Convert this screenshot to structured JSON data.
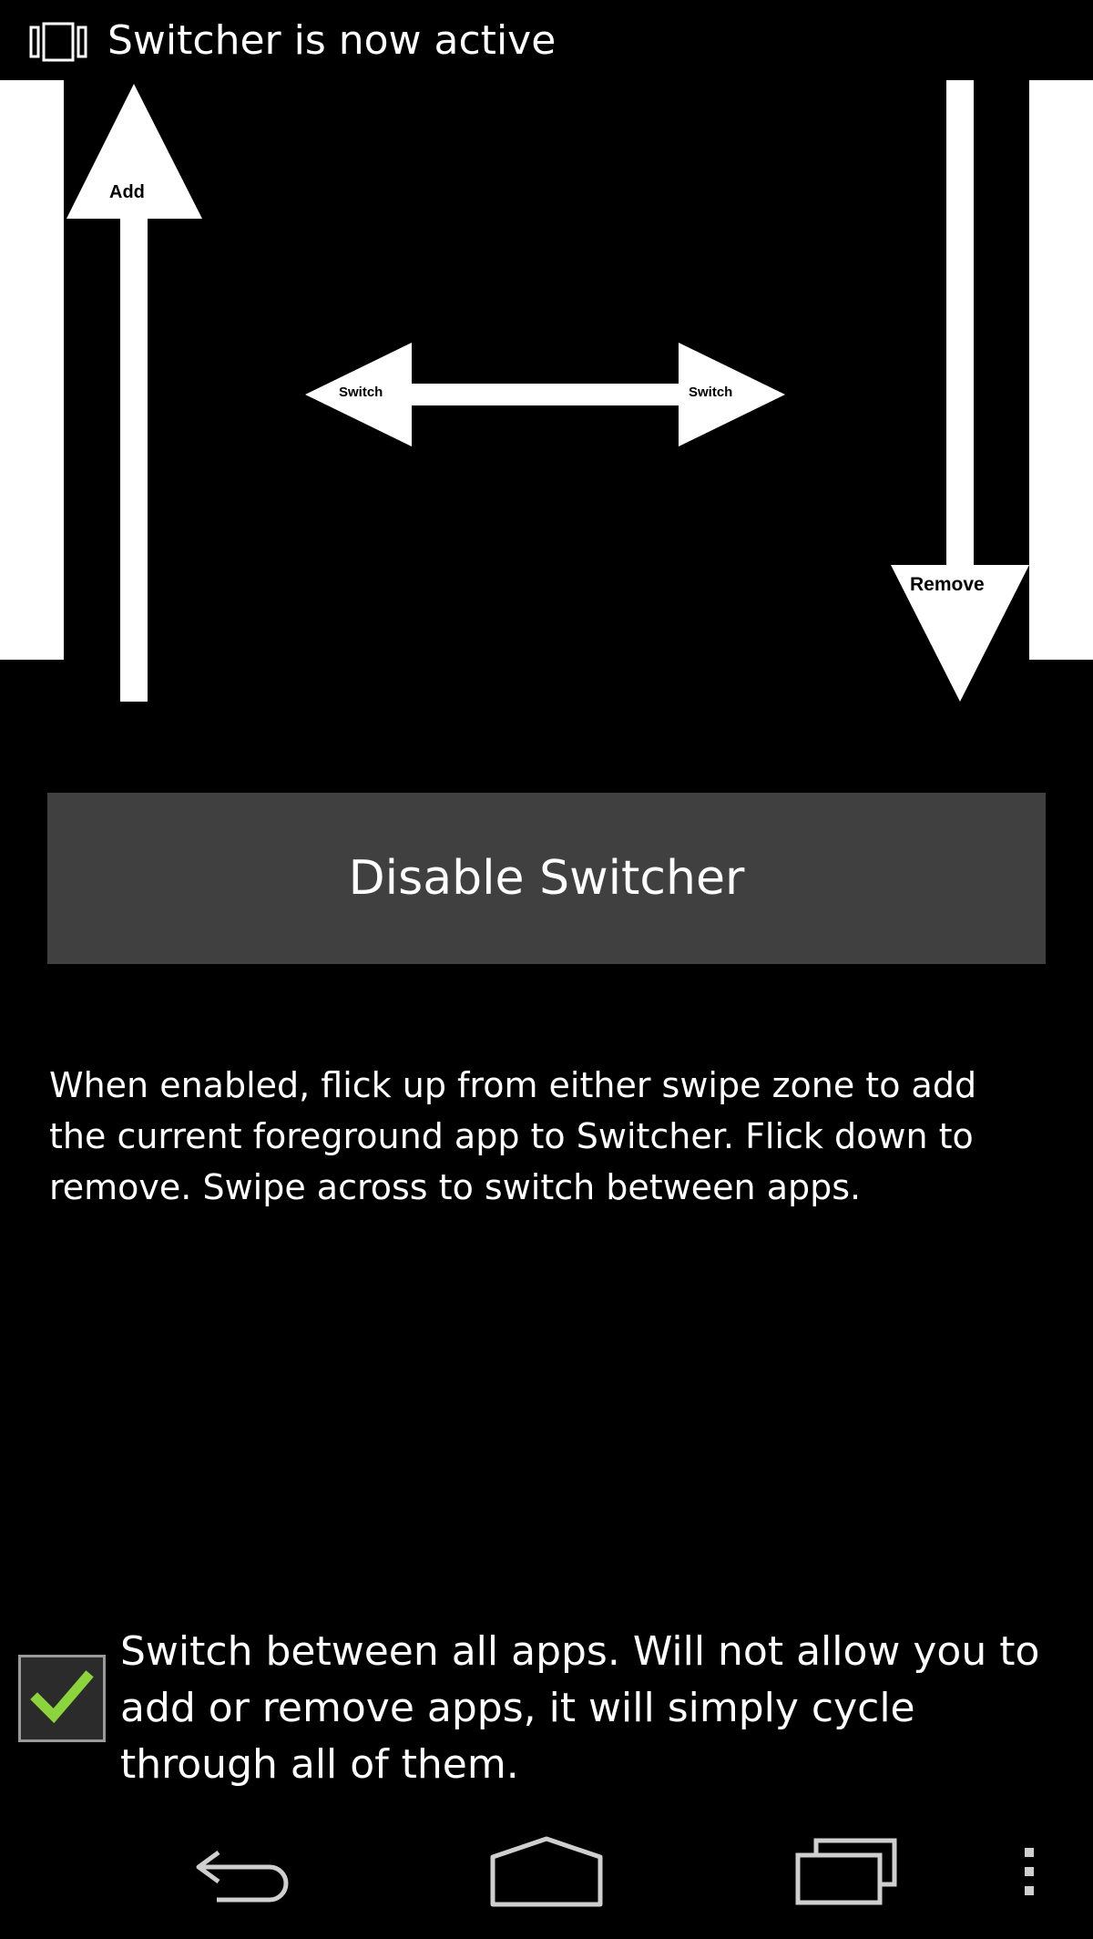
{
  "notification": {
    "icon": "switcher-icon",
    "text": "Switcher is now active"
  },
  "gesture_diagram": {
    "labels": {
      "add": "Add",
      "switch_left": "Switch",
      "switch_right": "Switch",
      "remove": "Remove"
    }
  },
  "disable_button": {
    "label": "Disable Switcher",
    "color": "#404040"
  },
  "description": {
    "text": "When enabled, flick up from either swipe zone to add the current foreground app to Switcher. Flick down to remove. Swipe across to switch between apps."
  },
  "switch_all_option": {
    "checked": true,
    "check_color": "#8cd43b",
    "label": "Switch between all apps. Will not allow you to add or remove apps, it will simply cycle through all of them."
  },
  "nav_bar": {
    "icons": [
      "back-icon",
      "home-icon",
      "recents-icon",
      "overflow-menu-icon"
    ]
  }
}
